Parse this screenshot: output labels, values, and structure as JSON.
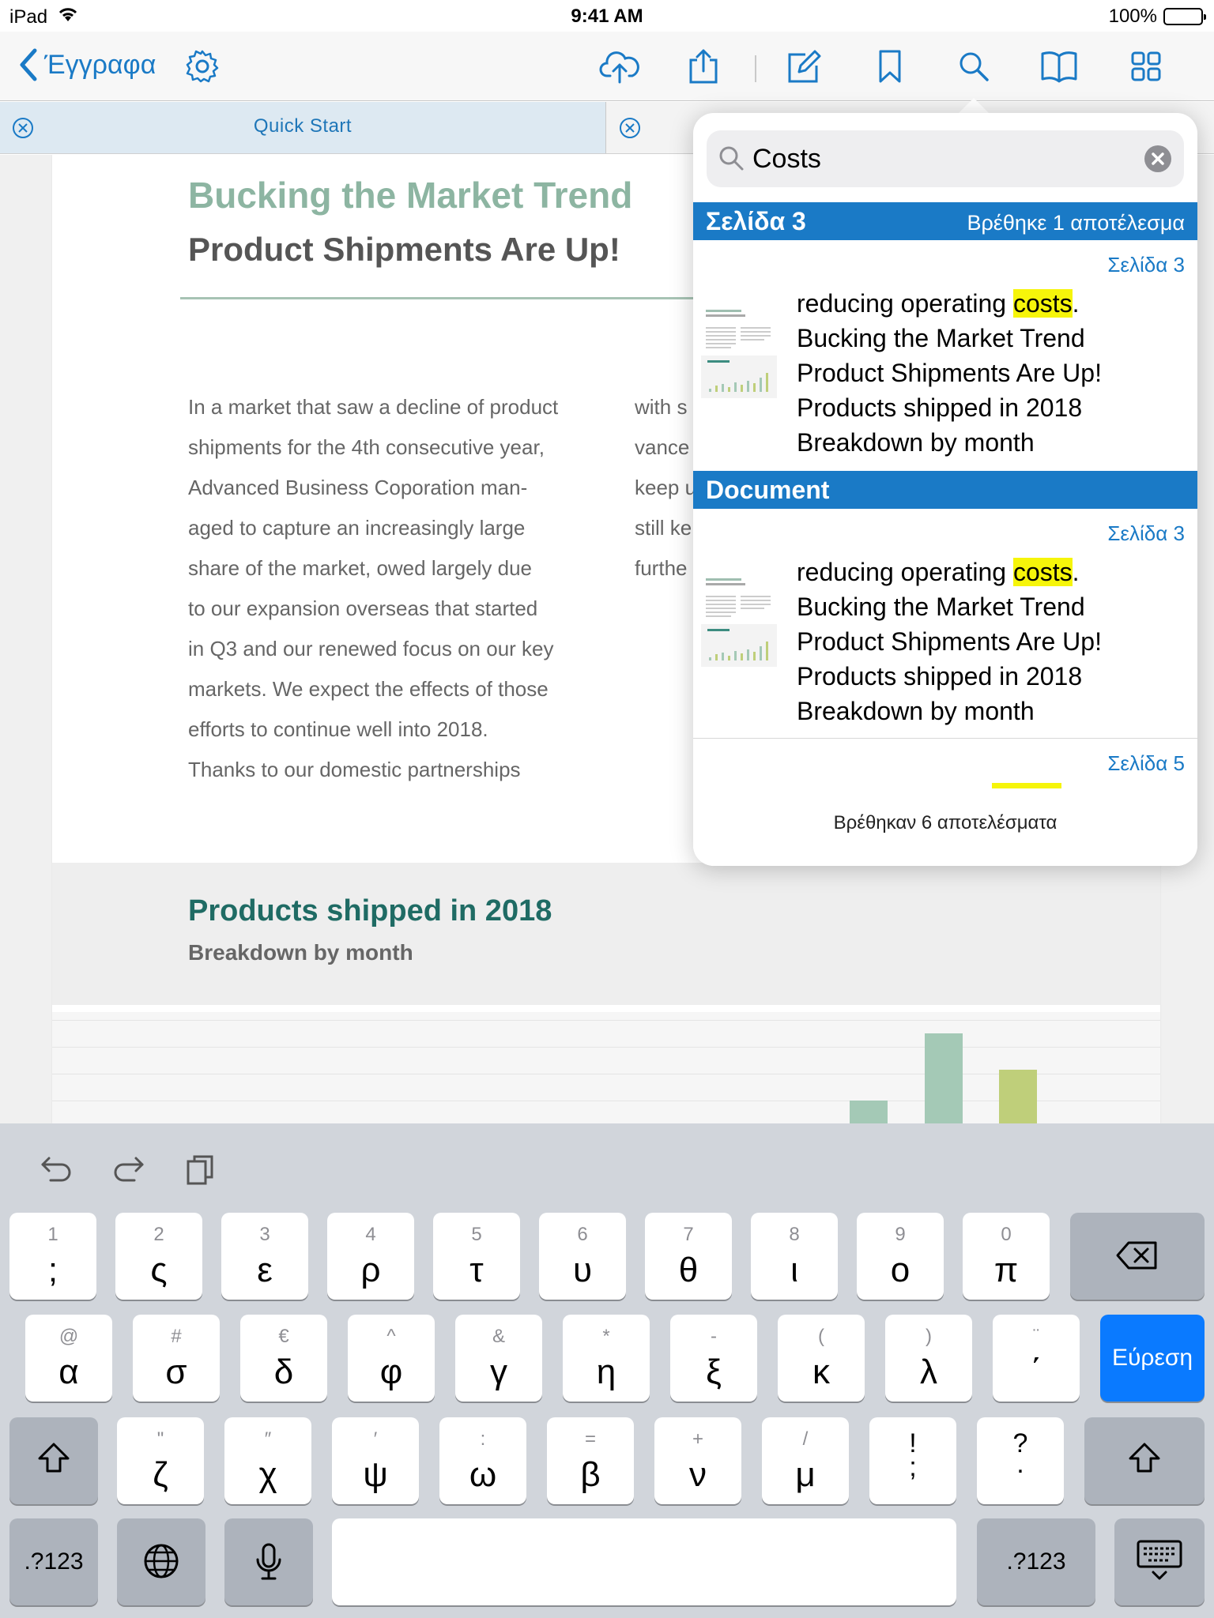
{
  "status_bar": {
    "device": "iPad",
    "time": "9:41 AM",
    "battery": "100%"
  },
  "nav": {
    "back_label": "Έγγραφα"
  },
  "tabs": [
    {
      "label": "Quick Start"
    }
  ],
  "document": {
    "title1": "Bucking the Market Trend",
    "title2": "Product Shipments Are Up!",
    "paragraph_lines": [
      "In a market that saw a decline of product",
      "shipments for the 4th consecutive year,",
      "Advanced Business Coporation man-",
      "aged to capture an increasingly large",
      "share of the market, owed largely due",
      "to our expansion overseas that started",
      "in Q3 and our renewed focus on our key",
      "markets. We expect the effects of those",
      "efforts to continue well into 2018.",
      "Thanks to our domestic partnerships"
    ],
    "col2_lines": [
      "with s",
      "vance",
      "keep u",
      "still ke",
      "furthe"
    ],
    "section_title": "Products shipped in 2018",
    "section_subtitle": "Breakdown by month"
  },
  "search": {
    "query": "Costs",
    "sections": [
      {
        "title": "Σελίδα 3",
        "count_label": "Βρέθηκε 1 αποτέλεσμα",
        "results": [
          {
            "page_label": "Σελίδα 3",
            "pre": "reducing operating ",
            "match": "costs",
            "post": ".",
            "lines": [
              "Bucking the Market Trend",
              "Product Shipments Are Up!",
              "Products shipped in 2018",
              "Breakdown by month"
            ]
          }
        ]
      },
      {
        "title": "Document",
        "results": [
          {
            "page_label": "Σελίδα 3",
            "pre": "reducing operating ",
            "match": "costs",
            "post": ".",
            "lines": [
              "Bucking the Market Trend",
              "Product Shipments Are Up!",
              "Products shipped in 2018",
              "Breakdown by month"
            ]
          },
          {
            "page_label": "Σελίδα 5"
          }
        ]
      }
    ],
    "total_label": "Βρέθηκαν 6 αποτελέσματα"
  },
  "keyboard": {
    "row1": [
      {
        "top": "1",
        "main": ";"
      },
      {
        "top": "2",
        "main": "ς"
      },
      {
        "top": "3",
        "main": "ε"
      },
      {
        "top": "4",
        "main": "ρ"
      },
      {
        "top": "5",
        "main": "τ"
      },
      {
        "top": "6",
        "main": "υ"
      },
      {
        "top": "7",
        "main": "θ"
      },
      {
        "top": "8",
        "main": "ι"
      },
      {
        "top": "9",
        "main": "ο"
      },
      {
        "top": "0",
        "main": "π"
      }
    ],
    "row2": [
      {
        "top": "@",
        "main": "α"
      },
      {
        "top": "#",
        "main": "σ"
      },
      {
        "top": "€",
        "main": "δ"
      },
      {
        "top": "^",
        "main": "φ"
      },
      {
        "top": "&",
        "main": "γ"
      },
      {
        "top": "*",
        "main": "η"
      },
      {
        "top": "-",
        "main": "ξ"
      },
      {
        "top": "(",
        "main": "κ"
      },
      {
        "top": ")",
        "main": "λ"
      },
      {
        "top": "¨",
        "main": "΄"
      }
    ],
    "row3": [
      {
        "top": "\"",
        "main": "ζ"
      },
      {
        "top": "″",
        "main": "χ"
      },
      {
        "top": "′",
        "main": "ψ"
      },
      {
        "top": ":",
        "main": "ω"
      },
      {
        "top": "=",
        "main": "β"
      },
      {
        "top": "+",
        "main": "ν"
      },
      {
        "top": "/",
        "main": "μ"
      },
      {
        "top": "!",
        "main": ";"
      },
      {
        "top": "?",
        "main": "."
      }
    ],
    "search_key": "Εύρεση",
    "numbers_key": ".?123"
  },
  "colors": {
    "accent": "#1a7ac6",
    "highlight": "#f6f50a",
    "title_green": "#8db5a2",
    "section_teal": "#1f6b64"
  }
}
